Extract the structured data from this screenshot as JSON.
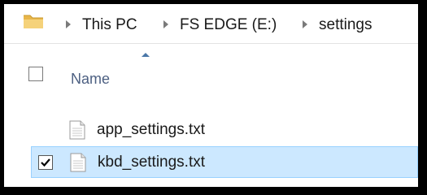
{
  "breadcrumb": {
    "folder_icon": "folder-icon",
    "segments": [
      "This PC",
      "FS EDGE (E:)",
      "settings"
    ]
  },
  "header": {
    "name_label": "Name",
    "sort": "ascending"
  },
  "files": [
    {
      "name": "app_settings.txt",
      "checked": false,
      "selected": false,
      "icon": "text-file-icon"
    },
    {
      "name": "kbd_settings.txt",
      "checked": true,
      "selected": true,
      "icon": "text-file-icon"
    }
  ],
  "colors": {
    "selection_fill": "#cce8ff",
    "selection_border": "#99d1ff",
    "header_text": "#4d6082",
    "frame": "#000000"
  }
}
